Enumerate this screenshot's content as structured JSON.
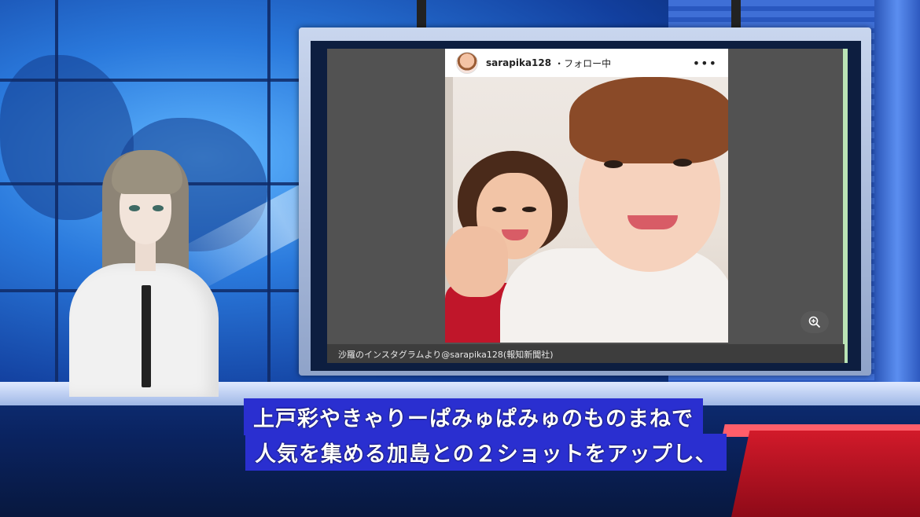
{
  "instagram": {
    "username": "sarapika128",
    "follow_status": "・フォロー中",
    "more_icon": "•••"
  },
  "photo_caption": "沙羅のインスタグラムより@sarapika128(報知新聞社)",
  "subtitles": {
    "line1": "上戸彩やきゃりーぱみゅぱみゅのものまねで",
    "line2": "人気を集める加島との２ショットをアップし、"
  },
  "icons": {
    "zoom": "zoom-in-icon",
    "more": "more-horizontal-icon"
  },
  "colors": {
    "subtitle_bg": "#2a2fd0",
    "studio_blue": "#2f7be0",
    "accent_red": "#d21a2a"
  }
}
